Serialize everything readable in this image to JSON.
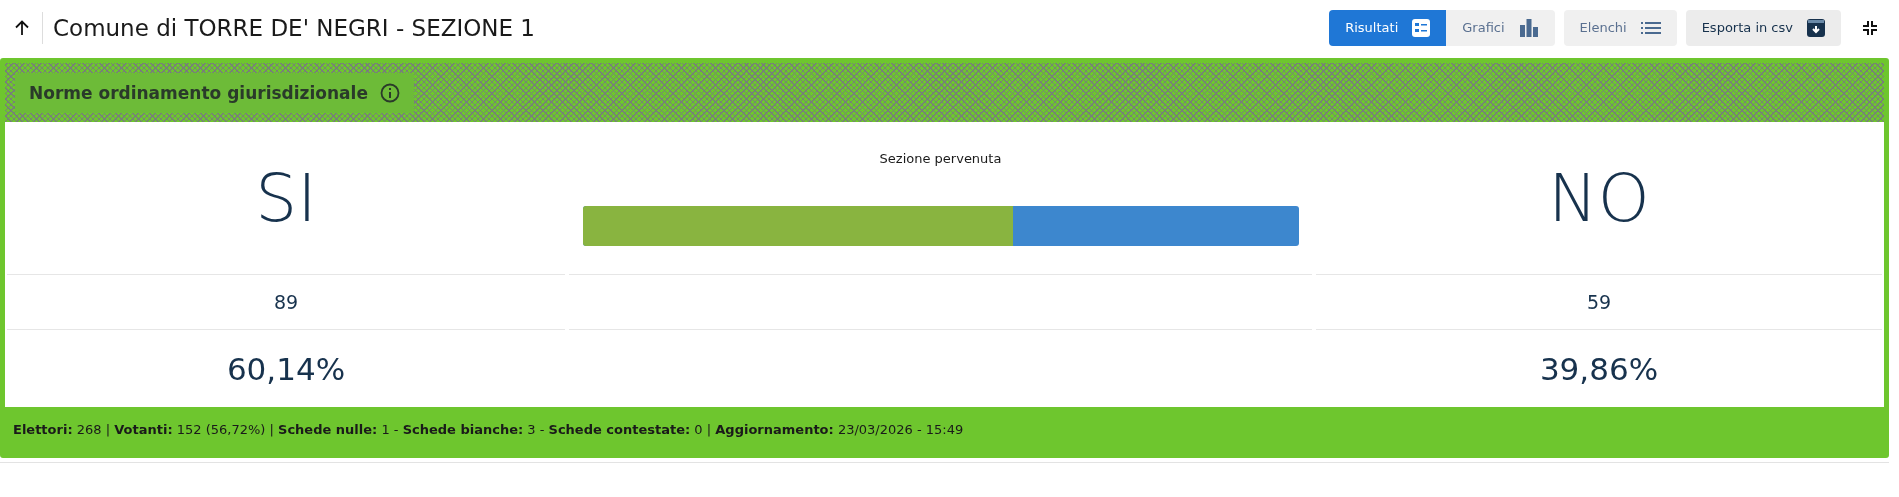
{
  "header": {
    "title": "Comune di TORRE DE' NEGRI - SEZIONE 1"
  },
  "view_tabs": [
    {
      "label": "Risultati",
      "kind": "list",
      "selected": true
    },
    {
      "label": "Grafici",
      "kind": "chart",
      "selected": false
    },
    {
      "label": "Elenchi",
      "kind": "bullets",
      "selected": false
    }
  ],
  "export_button": {
    "label": "Esporta in csv"
  },
  "card": {
    "title": "Norme ordinamento giurisdizionale",
    "status": "Sezione pervenuta",
    "yes": {
      "label": "SI",
      "votes": "89",
      "percent": "60,14%"
    },
    "no": {
      "label": "NO",
      "votes": "59",
      "percent": "39,86%"
    },
    "bar": {
      "level": 0.6014
    },
    "footer": "**Elettori:** 268 | **Votanti:** 152 (56,72%) | **Schede nulle:** 1 - **Schede bianche:** 3 - **Schede contestate:** 0 | **Aggiornamento:** 23/03/2026 - 15:49"
  }
}
